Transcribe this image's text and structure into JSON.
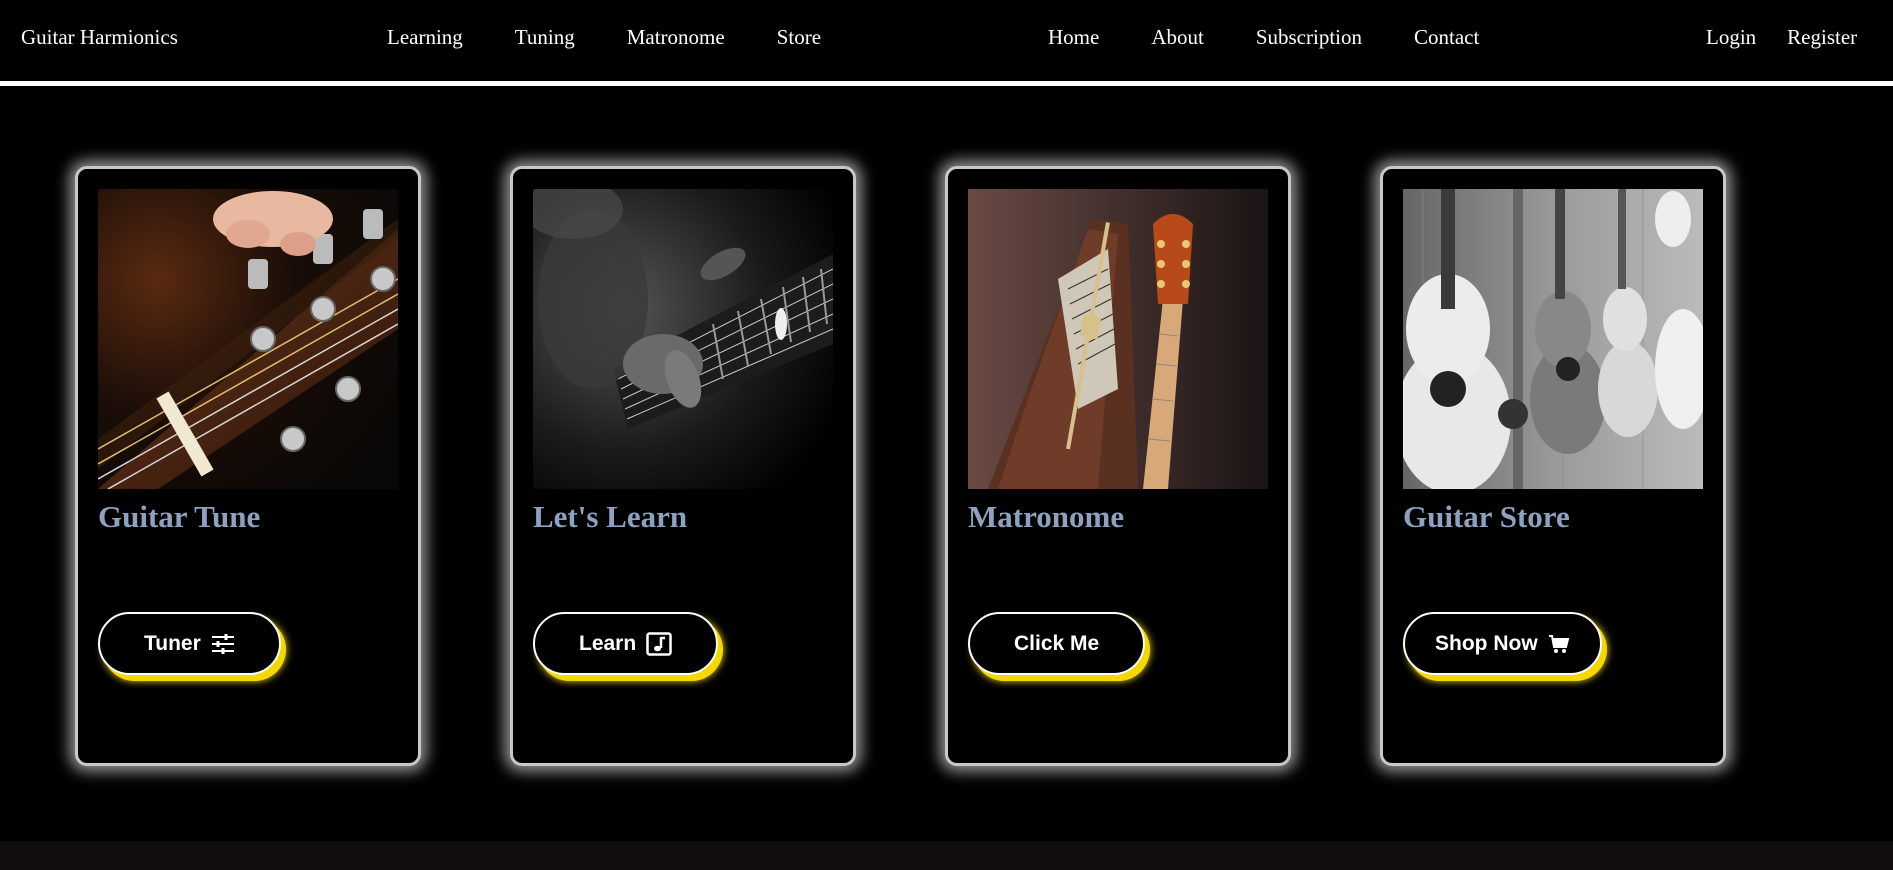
{
  "nav": {
    "brand": "Guitar Harmionics",
    "left": [
      "Learning",
      "Tuning",
      "Matronome",
      "Store"
    ],
    "mid": [
      "Home",
      "About",
      "Subscription",
      "Contact"
    ],
    "right": [
      "Login",
      "Register"
    ]
  },
  "cards": [
    {
      "title": "Guitar Tune",
      "button": "Tuner",
      "icon": "sliders-icon"
    },
    {
      "title": "Let's Learn",
      "button": "Learn",
      "icon": "music-note-icon"
    },
    {
      "title": "Matronome",
      "button": "Click Me",
      "icon": ""
    },
    {
      "title": "Guitar Store",
      "button": "Shop Now",
      "icon": "cart-icon"
    }
  ],
  "colors": {
    "background": "#000000",
    "title": "#8da2c0",
    "button_glow": "#f5d800",
    "footer": "#120d0d"
  }
}
